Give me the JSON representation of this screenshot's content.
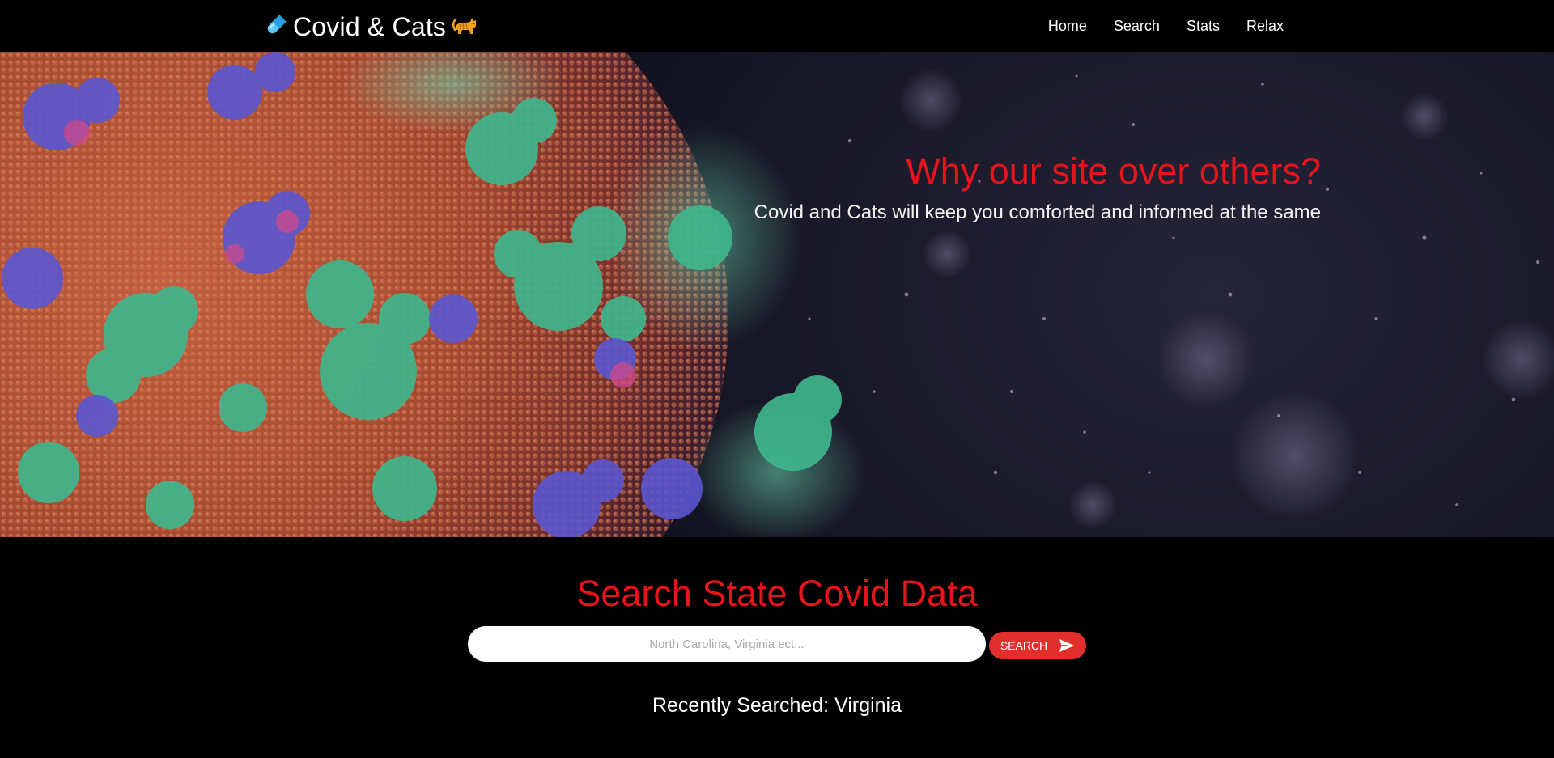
{
  "nav": {
    "brand": "Covid & Cats",
    "brand_icons": [
      "pill-icon",
      "cat-icon"
    ],
    "links": [
      {
        "label": "Home"
      },
      {
        "label": "Search"
      },
      {
        "label": "Stats"
      },
      {
        "label": "Relax"
      }
    ]
  },
  "hero": {
    "title": "Why our site over others?",
    "subtitle": "Covid and Cats will keep you comforted and informed at the same",
    "image": "coronavirus-particle-illustration"
  },
  "search": {
    "heading": "Search State Covid Data",
    "placeholder": "North Carolina, Virginia ect...",
    "value": "",
    "button_label": "SEARCH",
    "button_icon": "send-icon",
    "recent_prefix": "Recently Searched:",
    "recent_value": "Virginia"
  },
  "colors": {
    "accent": "#e8141b",
    "button": "#e12f2c",
    "background": "#000000"
  }
}
